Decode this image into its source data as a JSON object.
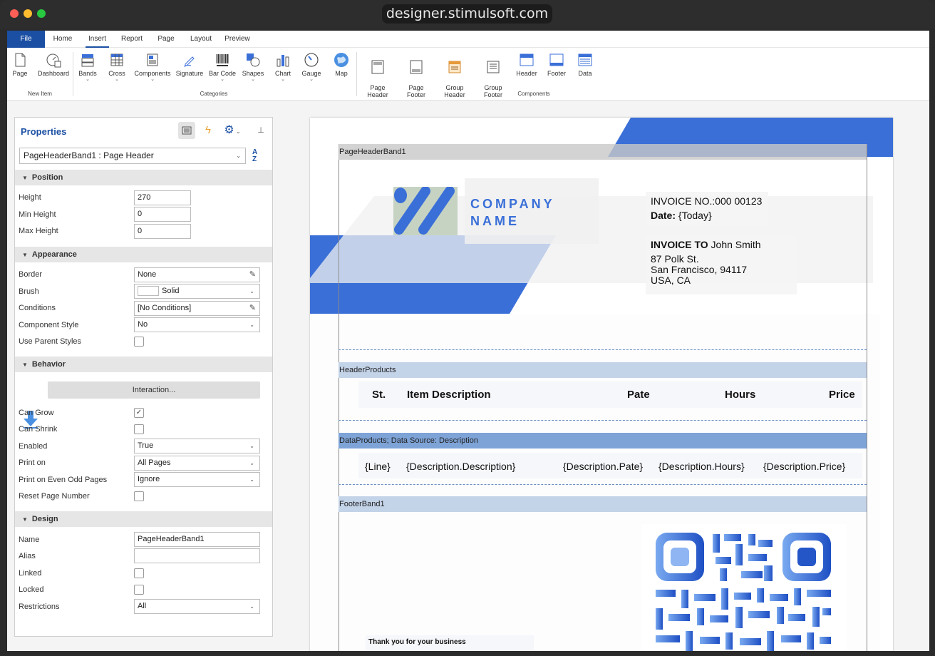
{
  "browser": {
    "url": "designer.stimulsoft.com"
  },
  "menu": {
    "file": "File",
    "tabs": [
      "Home",
      "Insert",
      "Report",
      "Page",
      "Layout",
      "Preview"
    ],
    "active_tab": "Insert"
  },
  "ribbon": {
    "new_item": {
      "label": "New Item",
      "buttons": [
        "Page",
        "Dashboard"
      ]
    },
    "categories": {
      "label": "Categories",
      "buttons": [
        "Bands",
        "Cross",
        "Components",
        "Signature",
        "Bar Code",
        "Shapes",
        "Chart",
        "Gauge",
        "Map"
      ]
    },
    "components": {
      "label": "Components",
      "buttons": [
        "Page\nHeader",
        "Page\nFooter",
        "Group\nHeader",
        "Group\nFooter",
        "Header",
        "Footer",
        "Data"
      ]
    }
  },
  "properties": {
    "title": "Properties",
    "selected": "PageHeaderBand1 : Page Header",
    "sort_label": "A\nZ",
    "sections": {
      "position": "Position",
      "appearance": "Appearance",
      "behavior": "Behavior",
      "design": "Design"
    },
    "position": {
      "height_label": "Height",
      "height": "270",
      "min_height_label": "Min Height",
      "min_height": "0",
      "max_height_label": "Max Height",
      "max_height": "0"
    },
    "appearance": {
      "border_label": "Border",
      "border": "None",
      "brush_label": "Brush",
      "brush": "Solid",
      "conditions_label": "Conditions",
      "conditions": "[No Conditions]",
      "component_style_label": "Component Style",
      "component_style": "No",
      "use_parent_styles_label": "Use Parent Styles"
    },
    "behavior": {
      "interaction": "Interaction...",
      "can_grow_label": "Can Grow",
      "can_grow": true,
      "can_shrink_label": "Can Shrink",
      "can_shrink": false,
      "enabled_label": "Enabled",
      "enabled": "True",
      "print_on_label": "Print on",
      "print_on": "All Pages",
      "print_even_odd_label": "Print on Even Odd Pages",
      "print_even_odd": "Ignore",
      "reset_page_number_label": "Reset Page Number"
    },
    "design": {
      "name_label": "Name",
      "name": "PageHeaderBand1",
      "alias_label": "Alias",
      "alias": "",
      "linked_label": "Linked",
      "locked_label": "Locked",
      "restrictions_label": "Restrictions",
      "restrictions": "All"
    }
  },
  "report": {
    "bands": {
      "page_header": "PageHeaderBand1",
      "header_products": "HeaderProducts",
      "data_products": "DataProducts; Data Source: Description",
      "footer": "FooterBand1"
    },
    "company_line1": "COMPANY",
    "company_line2": "NAME",
    "invoice_no": "INVOICE NO.:000 00123",
    "date_label": "Date:",
    "date_value": "{Today}",
    "invoice_to_label": "INVOICE TO",
    "invoice_to_name": "John Smith",
    "address_line1": "87 Polk St.",
    "address_line2": "San Francisco, 94117",
    "address_line3": "USA, CA",
    "columns": [
      "St.",
      "Item Description",
      "Pate",
      "Hours",
      "Price"
    ],
    "data_fields": [
      "{Line}",
      "{Description.Description}",
      "{Description.Pate}",
      "{Description.Hours}",
      "{Description.Price}"
    ],
    "thank_you": "Thank you for your business"
  },
  "colors": {
    "brand_blue": "#1b4fa3",
    "accent_blue": "#3a6fd8",
    "band_blue": "#7ea3d6"
  }
}
